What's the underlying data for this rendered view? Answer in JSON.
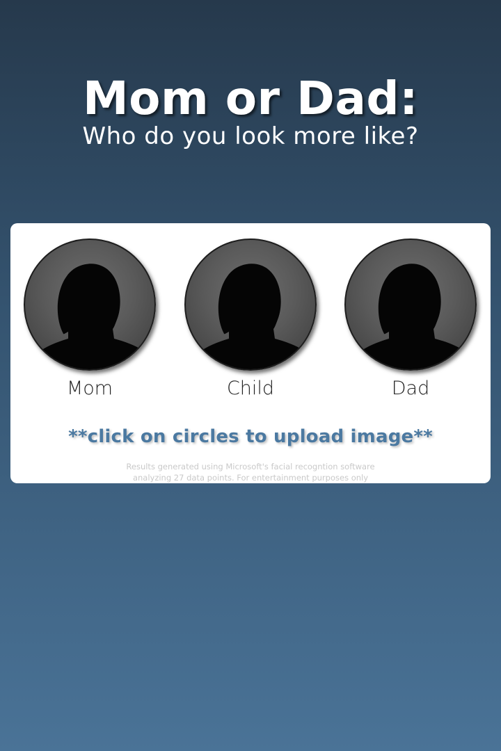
{
  "header": {
    "title": "Mom or Dad:",
    "subtitle": "Who do you look more like?"
  },
  "faces": [
    {
      "label": "Mom",
      "icon": "person-silhouette-icon"
    },
    {
      "label": "Child",
      "icon": "person-silhouette-icon"
    },
    {
      "label": "Dad",
      "icon": "person-silhouette-icon"
    }
  ],
  "instruction": "**click on circles to upload image**",
  "disclaimer": {
    "line1": "Results generated using Microsoft's facial recogntion software",
    "line2": "analyzing 27 data points. For entertainment purposes only"
  },
  "colors": {
    "background_top": "#26394c",
    "background_bottom": "#4a7397",
    "accent": "#4b79a1",
    "card": "#ffffff"
  }
}
